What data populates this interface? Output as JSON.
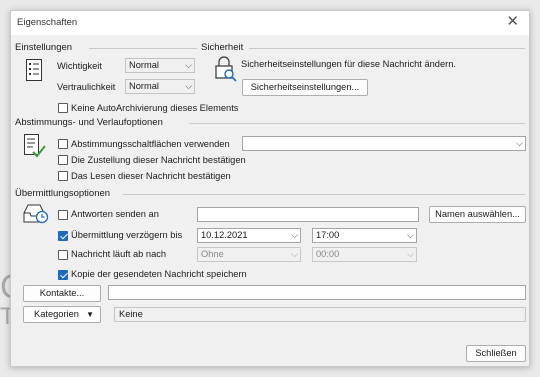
{
  "background": {
    "text_large": "C",
    "text_small": "T"
  },
  "dialog": {
    "title": "Eigenschaften",
    "close_symbol": "✕"
  },
  "settings": {
    "heading": "Einstellungen",
    "importance_label": "Wichtigkeit",
    "importance_value": "Normal",
    "sensitivity_label": "Vertraulichkeit",
    "sensitivity_value": "Normal",
    "no_autoarchive_label": "Keine AutoArchivierung dieses Elements",
    "no_autoarchive_checked": false
  },
  "security": {
    "heading": "Sicherheit",
    "description": "Sicherheitseinstellungen für diese Nachricht ändern.",
    "button_label": "Sicherheitseinstellungen..."
  },
  "voting": {
    "heading": "Abstimmungs- und Verlaufoptionen",
    "use_voting_label": "Abstimmungsschaltflächen verwenden",
    "use_voting_checked": false,
    "voting_value": "",
    "delivery_receipt_label": "Die Zustellung dieser Nachricht bestätigen",
    "delivery_receipt_checked": false,
    "read_receipt_label": "Das Lesen dieser Nachricht bestätigen",
    "read_receipt_checked": false
  },
  "delivery": {
    "heading": "Übermittlungsoptionen",
    "replies_label": "Antworten senden an",
    "replies_checked": false,
    "replies_value": "",
    "select_names_button": "Namen auswählen...",
    "delay_label": "Übermittlung verzögern bis",
    "delay_checked": true,
    "delay_date": "10.12.2021",
    "delay_time": "17:00",
    "expires_label": "Nachricht läuft ab nach",
    "expires_checked": false,
    "expires_date": "Ohne",
    "expires_time": "00:00",
    "save_copy_label": "Kopie der gesendeten Nachricht speichern",
    "save_copy_checked": true
  },
  "contacts": {
    "button_label": "Kontakte...",
    "value": ""
  },
  "categories": {
    "button_label": "Kategorien",
    "value": "Keine"
  },
  "footer": {
    "close_button": "Schließen"
  },
  "icons": {
    "caret": "⌵",
    "settings_icon": "list-icon",
    "security_icon": "lock-search-icon",
    "voting_icon": "checklist-icon",
    "delivery_icon": "tray-clock-icon"
  },
  "colors": {
    "accent": "#1f6ac0",
    "dialog_bg": "#f0f0f0"
  }
}
